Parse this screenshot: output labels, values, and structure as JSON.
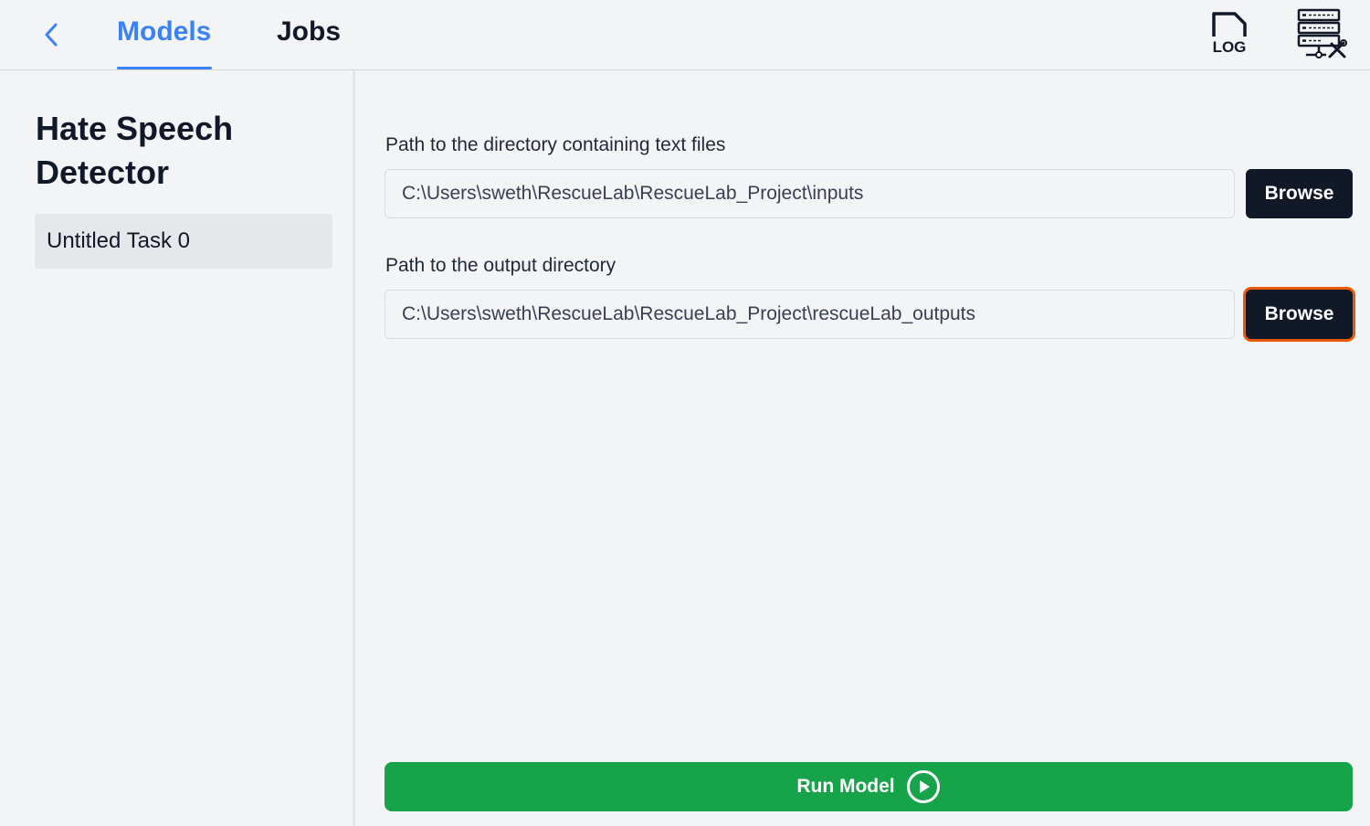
{
  "header": {
    "tabs": [
      {
        "label": "Models",
        "active": true
      },
      {
        "label": "Jobs",
        "active": false
      }
    ],
    "log_icon_text": "LOG",
    "accent_color": "#3b82f6"
  },
  "sidebar": {
    "model_title": "Hate Speech Detector",
    "tasks": [
      {
        "label": "Untitled Task 0",
        "selected": true
      }
    ]
  },
  "form": {
    "input_dir": {
      "label": "Path to the directory containing text files",
      "value": "C:\\Users\\sweth\\RescueLab\\RescueLab_Project\\inputs",
      "browse_label": "Browse"
    },
    "output_dir": {
      "label": "Path to the output directory",
      "value": "C:\\Users\\sweth\\RescueLab\\RescueLab_Project\\rescueLab_outputs",
      "browse_label": "Browse"
    }
  },
  "run": {
    "label": "Run Model",
    "color": "#16a34a"
  },
  "icons": {
    "back": "chevron-left-icon",
    "log": "log-file-icon",
    "server": "server-settings-icon",
    "run": "play-circle-icon"
  }
}
